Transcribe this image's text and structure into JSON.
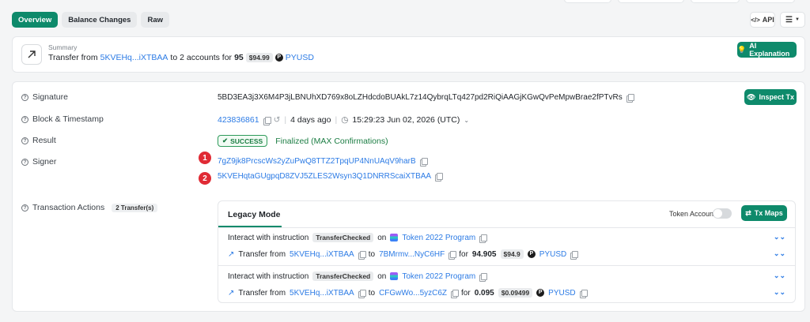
{
  "tabs": [
    {
      "label": "Overview",
      "active": true
    },
    {
      "label": "Balance Changes",
      "active": false
    },
    {
      "label": "Raw",
      "active": false
    }
  ],
  "toolbar": {
    "api_label": "API",
    "api_icon": "code-icon",
    "view_icon": "list-settings-icon"
  },
  "summary": {
    "label": "Summary",
    "prefix": "Transfer from",
    "from": "5KVEHq...iXTBAA",
    "mid": "to 2 accounts for",
    "amount": "95",
    "usd": "$94.99",
    "token": "PYUSD",
    "ai_button": "AI Explanation"
  },
  "signature": {
    "label": "Signature",
    "value": "5BD3EA3j3X6M4P3jLBNUhXD769x8oLZHdcdoBUAkL7z14QybrqLTq427pd2RiQiAAGjKGwQvPeMpwBrae2fPTvRs",
    "inspect_button": "Inspect Tx"
  },
  "block": {
    "label": "Block & Timestamp",
    "slot": "423836861",
    "age": "4 days ago",
    "timestamp": "15:29:23 Jun 02, 2026 (UTC)"
  },
  "result": {
    "label": "Result",
    "status": "SUCCESS",
    "detail": "Finalized (MAX Confirmations)"
  },
  "signer": {
    "label": "Signer",
    "items": [
      {
        "index": "1",
        "address": "7gZ9jk8PrcscWs2yZuPwQ8TTZ2TpqUP4NnUAqV9harB"
      },
      {
        "index": "2",
        "address": "5KVEHqtaGUgpqD8ZVJ5ZLES2Wsyn3Q1DNRRScaiXTBAA"
      }
    ]
  },
  "actions": {
    "label": "Transaction Actions",
    "count_badge": "2 Transfer(s)",
    "mode_tab": "Legacy Mode",
    "token_account_label": "Token Account",
    "tx_maps_button": "Tx Maps",
    "items": [
      {
        "interact": "Interact with instruction",
        "instruction": "TransferChecked",
        "on": "on",
        "program": "Token 2022 Program",
        "transfer_prefix": "Transfer from",
        "from": "5KVEHq...iXTBAA",
        "to_word": "to",
        "to": "7BMrmv...NyC6HF",
        "for_word": "for",
        "amount": "94.905",
        "usd": "$94.9",
        "token": "PYUSD"
      },
      {
        "interact": "Interact with instruction",
        "instruction": "TransferChecked",
        "on": "on",
        "program": "Token 2022 Program",
        "transfer_prefix": "Transfer from",
        "from": "5KVEHq...iXTBAA",
        "to_word": "to",
        "to": "CFGwWo...5yzC6Z",
        "for_word": "for",
        "amount": "0.095",
        "usd": "$0.09499",
        "token": "PYUSD"
      }
    ]
  },
  "colors": {
    "accent": "#0e8a6b",
    "link": "#2c7be5",
    "success": "#1b7d43",
    "marker": "#e02b35"
  }
}
